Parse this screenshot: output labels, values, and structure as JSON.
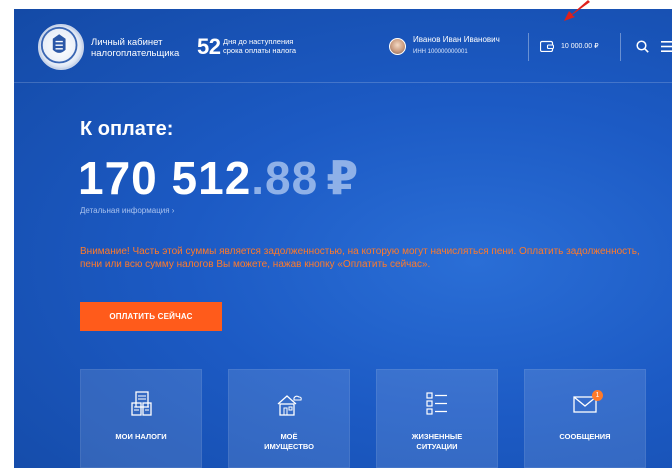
{
  "header": {
    "cabinet_title_line1": "Личный кабинет",
    "cabinet_title_line2": "налогоплательщика",
    "days_count": "52",
    "days_text_line1": "Дня до наступления",
    "days_text_line2": "срока оплаты налога",
    "user_name": "Иванов Иван Иванович",
    "user_inn": "ИНН 100000000001",
    "balance": "10 000.00 ₽"
  },
  "main": {
    "to_pay_label": "К оплате:",
    "amount_whole": "170 512",
    "amount_fraction": ".88",
    "currency": "₽",
    "details_link": "Детальная информация ›",
    "warning": "Внимание! Часть этой суммы является задолженностью, на которую могут начисляться пени. Оплатить задолженность, пени или всю сумму налогов Вы можете, нажав кнопку «Оплатить сейчас».",
    "pay_button": "ОПЛАТИТЬ СЕЙЧАС"
  },
  "tiles": [
    {
      "label_line1": "МОИ НАЛОГИ",
      "label_line2": ""
    },
    {
      "label_line1": "МОЁ",
      "label_line2": "ИМУЩЕСТВО"
    },
    {
      "label_line1": "ЖИЗНЕННЫЕ",
      "label_line2": "СИТУАЦИИ"
    },
    {
      "label_line1": "СООБЩЕНИЯ",
      "label_line2": ""
    }
  ],
  "messages_badge": "1",
  "colors": {
    "background": "#1c5ac4",
    "accent": "#ff5b1b",
    "warning_text": "#ff7a2a",
    "arrow": "#e0201b"
  },
  "icons": {
    "logo": "fns-emblem-icon",
    "wallet": "wallet-icon",
    "search": "search-icon",
    "menu": "hamburger-menu-icon",
    "taxes": "tax-documents-icon",
    "property": "house-icon",
    "situations": "list-icon",
    "messages": "envelope-icon"
  }
}
